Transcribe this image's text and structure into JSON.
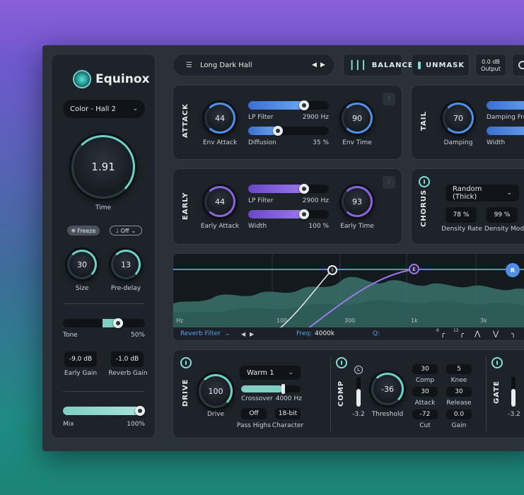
{
  "app": {
    "name": "Equinox"
  },
  "left": {
    "color_preset": "Color - Hall 2",
    "time": {
      "value": "1.91",
      "label": "Time"
    },
    "freeze_label": "Freeze",
    "sync_label": "Off",
    "size": {
      "value": "30",
      "label": "Size"
    },
    "predelay": {
      "value": "13",
      "label": "Pre-delay"
    },
    "tone": {
      "label": "Tone",
      "value": "50%",
      "level": 0.5
    },
    "early_gain": {
      "value": "-9.0 dB",
      "label": "Early Gain"
    },
    "reverb_gain": {
      "value": "-1.0 dB",
      "label": "Reverb Gain"
    },
    "mix": {
      "label": "Mix",
      "value": "100%",
      "level": 1.0
    }
  },
  "topbar": {
    "preset_name": "Long Dark Hall",
    "balance_label": "BALANCE",
    "unmask_label": "UNMASK",
    "output_value": "0.0 dB",
    "output_label": "Output"
  },
  "attack": {
    "title": "ATTACK",
    "env_attack": {
      "value": "44",
      "label": "Env Attack"
    },
    "lp_filter": {
      "label": "LP Filter",
      "value": "2900 Hz",
      "level": 0.72
    },
    "diffusion": {
      "label": "Diffusion",
      "value": "35 %",
      "level": 0.35
    },
    "env_time": {
      "value": "90",
      "label": "Env Time"
    }
  },
  "tail": {
    "title": "TAIL",
    "damping": {
      "value": "70",
      "label": "Damping"
    },
    "damping_freq_label": "Damping Freq",
    "width_label": "Width"
  },
  "early": {
    "title": "EARLY",
    "early_attack": {
      "value": "44",
      "label": "Early Attack"
    },
    "lp_filter": {
      "label": "LP Filter",
      "value": "2900 Hz",
      "level": 0.72
    },
    "width": {
      "label": "Width",
      "value": "100 %",
      "level": 0.72
    },
    "early_time": {
      "value": "93",
      "label": "Early Time"
    }
  },
  "chorus": {
    "title": "CHORUS",
    "mode": "Random (Thick)",
    "density_rate": {
      "value": "78 %",
      "label": "Density Rate"
    },
    "density_mod": {
      "value": "99 %",
      "label": "Density Mod"
    }
  },
  "eq": {
    "ticks": [
      "Hz",
      "100",
      "300",
      "1k",
      "3k"
    ],
    "nodes": [
      "I",
      "E",
      "R"
    ],
    "filter_name": "Reverb Filter",
    "freq_label": "Freq:",
    "freq_value": "4000k",
    "q_label": "Q:",
    "shape_labels": [
      "6",
      "12"
    ]
  },
  "drive": {
    "title": "DRIVE",
    "drive": {
      "value": "100",
      "label": "Drive"
    },
    "mode": "Warm 1",
    "crossover": {
      "label": "Crossover",
      "value": "4000 Hz",
      "level": 0.72
    },
    "pass_highs": {
      "value": "Off",
      "label": "Pass Highs"
    },
    "character": {
      "value": "18-bit",
      "label": "Character"
    }
  },
  "comp": {
    "title": "COMP",
    "meter_label": "L",
    "meter_value": "-3.2",
    "threshold": {
      "value": "-36",
      "label": "Threshold"
    },
    "params": [
      {
        "value": "30",
        "label": "Comp"
      },
      {
        "value": "5",
        "label": "Knee"
      },
      {
        "value": "30",
        "label": "Attack"
      },
      {
        "value": "30",
        "label": "Release"
      },
      {
        "value": "-72",
        "label": "Cut"
      },
      {
        "value": "0.0",
        "label": "Gain"
      }
    ]
  },
  "gate": {
    "title": "GATE",
    "meter_value": "-3.2"
  }
}
